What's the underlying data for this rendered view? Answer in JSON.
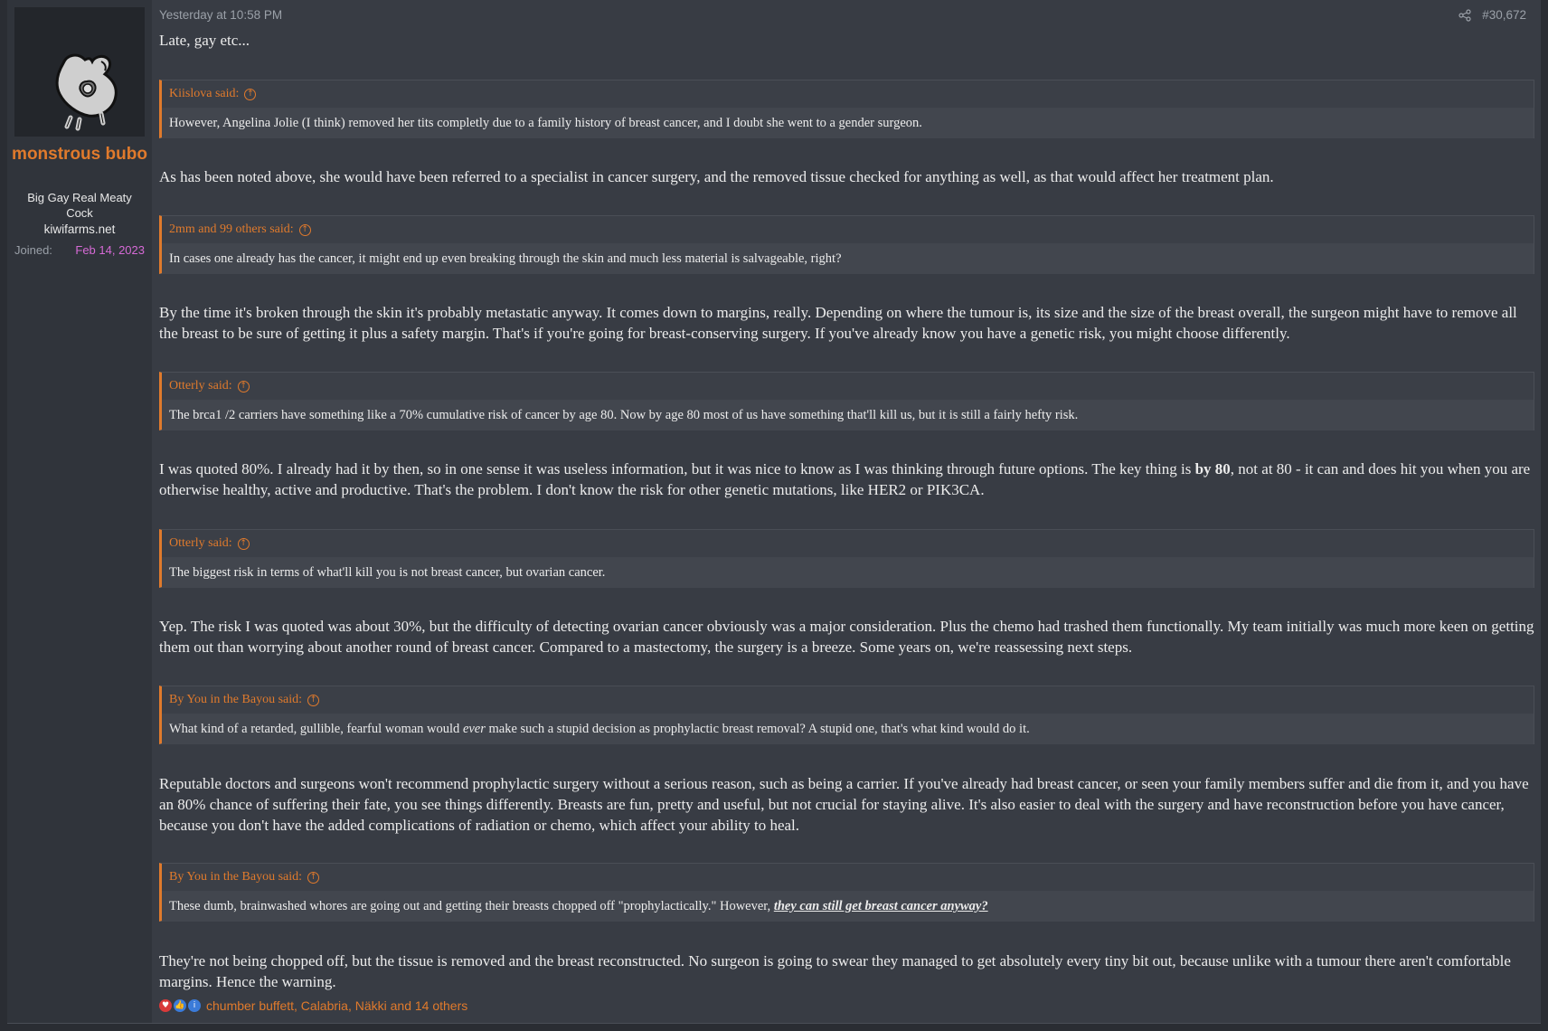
{
  "user": {
    "name": "monstrous bubo",
    "title": "Big Gay Real Meaty Cock",
    "banner": "kiwifarms.net",
    "joined_label": "Joined:",
    "joined_value": "Feb 14, 2023",
    "name_color": "#e07a2c",
    "avatar_icon": "avatar-image"
  },
  "post": {
    "date": "Yesterday at 10:58 PM",
    "number": "#30,672",
    "share_icon": "share-icon",
    "intro": "Late, gay etc...",
    "quotes": [
      {
        "author": "Kiislova said:",
        "text": "However, Angelina Jolie (I think) removed her tits completly due to a family history of breast cancer, and I doubt she went to a gender surgeon."
      },
      {
        "author": "2mm and 99 others said:",
        "text": "In cases one already has the cancer, it might end up even breaking through the skin and much less material is salvageable, right?"
      },
      {
        "author": "Otterly said:",
        "text": "The brca1 /2 carriers have something like a 70% cumulative risk of cancer by age 80. Now by age 80 most of us have something that'll kill us, but it is still a fairly hefty risk."
      },
      {
        "author": "Otterly said:",
        "text": "The biggest risk in terms of what'll kill you is not breast cancer, but ovarian cancer."
      },
      {
        "author": "By You in the Bayou said:",
        "text_a": "What kind of a retarded, gullible, fearful woman would ",
        "text_em": "ever",
        "text_b": " make such a stupid decision as prophylactic breast removal? A stupid one, that's what kind would do it."
      },
      {
        "author": "By You in the Bayou said:",
        "text_a": "These dumb, brainwashed whores are going out and getting their breasts chopped off \"prophylactically.\" However, ",
        "text_em": "they can still get breast cancer anyway?"
      }
    ],
    "replies": [
      "As has been noted above, she would have been referred to a specialist in cancer surgery, and the removed tissue checked for anything as well, as that would affect her treatment plan.",
      "By the time it's broken through the skin it's probably metastatic anyway. It comes down to margins, really. Depending on where the tumour is, its size and the size of the breast overall, the surgeon might have to remove all the breast to be sure of getting it plus a safety margin. That's if you're going for breast-conserving surgery. If you've already know you have a genetic risk, you might choose differently.",
      {
        "a": "I was quoted 80%. I already had it by then, so in one sense it was useless information, but it was nice to know as I was thinking through future options. The key thing is ",
        "bold": "by 80",
        "b": ", not at 80 - it can and does hit you when you are otherwise healthy, active and productive. That's the problem. I don't know the risk for other genetic mutations, like HER2 or PIK3CA."
      },
      "Yep. The risk I was quoted was about 30%, but the difficulty of detecting ovarian cancer obviously was a major consideration. Plus the chemo had trashed them functionally. My team initially was much more keen on getting them out than worrying about another round of breast cancer. Compared to a mastectomy, the surgery is a breeze. Some years on, we're reassessing next steps.",
      "Reputable doctors and surgeons won't recommend prophylactic surgery without a serious reason, such as being a carrier. If you've already had breast cancer, or seen your family members suffer and die from it, and you have an 80% chance of suffering their fate, you see things differently. Breasts are fun, pretty and useful, but not crucial for staying alive. It's also easier to deal with the surgery and have reconstruction before you have cancer, because you don't have the added complications of radiation or chemo, which affect your ability to heal.",
      "They're not being chopped off, but the tissue is removed and the breast reconstructed. No surgeon is going to swear they managed to get absolutely every tiny bit out, because unlike with a tumour there aren't comfortable margins. Hence the warning."
    ],
    "reactions": {
      "icons": [
        "heart-reaction-icon",
        "like-reaction-icon",
        "informative-reaction-icon"
      ],
      "names": "chumber buffett, Calabria, Näkki and 14 others"
    }
  }
}
